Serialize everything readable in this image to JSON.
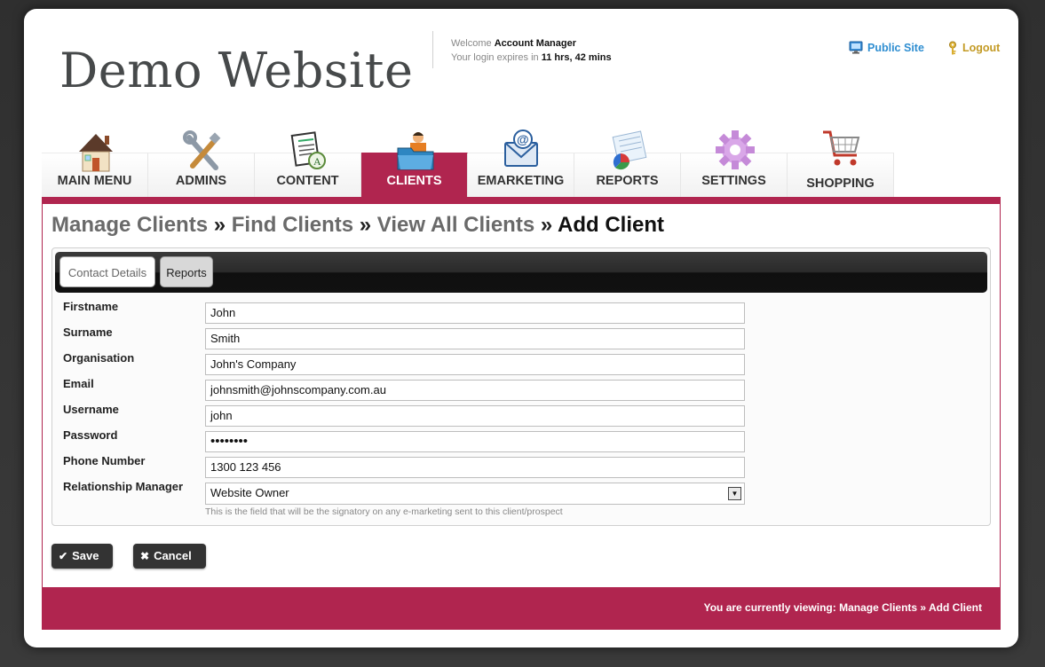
{
  "header": {
    "logo": "Demo Website",
    "welcome_prefix": "Welcome",
    "user_name": "Account Manager",
    "expires_prefix": "Your login expires in",
    "expires_value": "11 hrs, 42 mins",
    "public_site": "Public Site",
    "logout": "Logout"
  },
  "nav": [
    {
      "label": "MAIN MENU",
      "icon": "house-icon"
    },
    {
      "label": "ADMINS",
      "icon": "tools-icon"
    },
    {
      "label": "CONTENT",
      "icon": "document-icon"
    },
    {
      "label": "CLIENTS",
      "icon": "client-folder-icon",
      "active": true
    },
    {
      "label": "EMARKETING",
      "icon": "email-icon"
    },
    {
      "label": "REPORTS",
      "icon": "report-chart-icon"
    },
    {
      "label": "SETTINGS",
      "icon": "gear-icon"
    },
    {
      "label": "SHOPPING",
      "icon": "shopping-cart-icon"
    }
  ],
  "breadcrumb": {
    "manage": "Manage Clients",
    "find": "Find Clients",
    "view": "View All Clients",
    "current": "Add Client",
    "separator": "»"
  },
  "tabs": {
    "contact": "Contact Details",
    "reports": "Reports"
  },
  "form": {
    "firstname": {
      "label": "Firstname",
      "value": "John"
    },
    "surname": {
      "label": "Surname",
      "value": "Smith"
    },
    "organisation": {
      "label": "Organisation",
      "value": "John's Company"
    },
    "email": {
      "label": "Email",
      "value": "johnsmith@johnscompany.com.au"
    },
    "username": {
      "label": "Username",
      "value": "john"
    },
    "password": {
      "label": "Password",
      "value": "••••••••"
    },
    "phone": {
      "label": "Phone Number",
      "value": "1300 123 456"
    },
    "manager": {
      "label": "Relationship Manager",
      "value": "Website Owner"
    },
    "hint": "This is the field that will be the signatory on any e-marketing sent to this client/prospect"
  },
  "buttons": {
    "save": "Save",
    "cancel": "Cancel"
  },
  "footer": {
    "text": "You are currently viewing: Manage Clients » Add Client"
  },
  "colors": {
    "accent": "#b0254f",
    "link_blue": "#2f8ed1",
    "logout_gold": "#c39a24"
  }
}
